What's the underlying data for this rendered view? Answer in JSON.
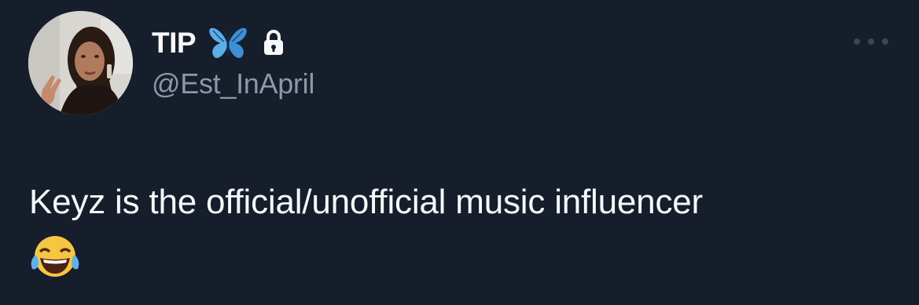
{
  "tweet": {
    "display_name": "TIP",
    "handle": "@Est_InApril",
    "text": "Keyz is the official/unofficial music influencer"
  },
  "icons": {
    "name_emoji": "butterfly-icon",
    "protected": "lock-icon",
    "menu": "more-options-icon",
    "text_emoji": "face-with-tears-of-joy-emoji"
  },
  "colors": {
    "background": "#161d2b",
    "name_text": "#f7f9f9",
    "handle_text": "#8b98a5",
    "butterfly": "#4fa3e8"
  }
}
